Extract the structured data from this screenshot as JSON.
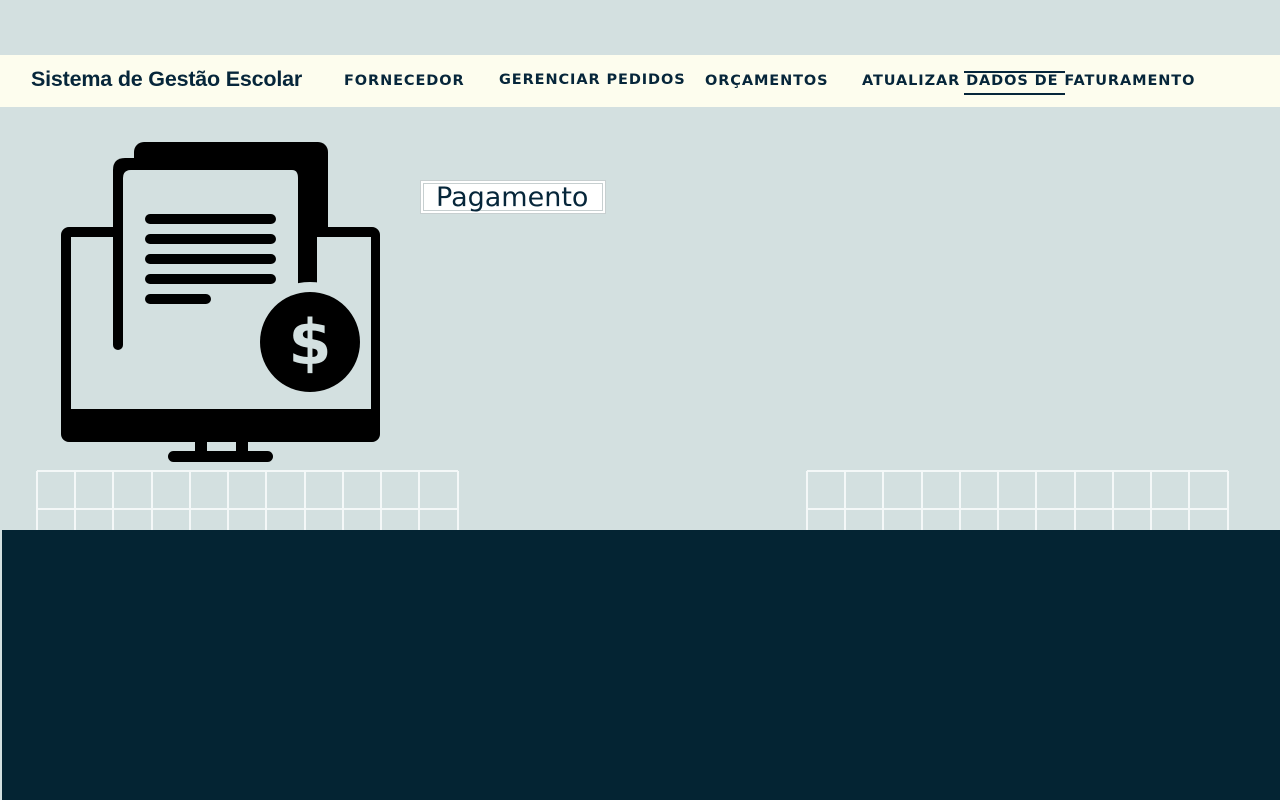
{
  "app": {
    "brand": "Sistema de Gestão Escolar"
  },
  "nav": {
    "items": [
      {
        "label": "FORNECEDOR"
      },
      {
        "label": "GERENCIAR PEDIDOS"
      },
      {
        "label": "ORÇAMENTOS"
      },
      {
        "label": "ATUALIZAR DADOS DE FATURAMENTO"
      }
    ]
  },
  "main": {
    "title": "Pagamento",
    "illustration_icon": "invoice-monitor-dollar-icon"
  },
  "colors": {
    "page_background": "#d3e0e0",
    "navbar_background": "#fdfdee",
    "text_dark": "#06263a",
    "footer_background": "#042433",
    "grid_lines": "#f4f8f8"
  }
}
